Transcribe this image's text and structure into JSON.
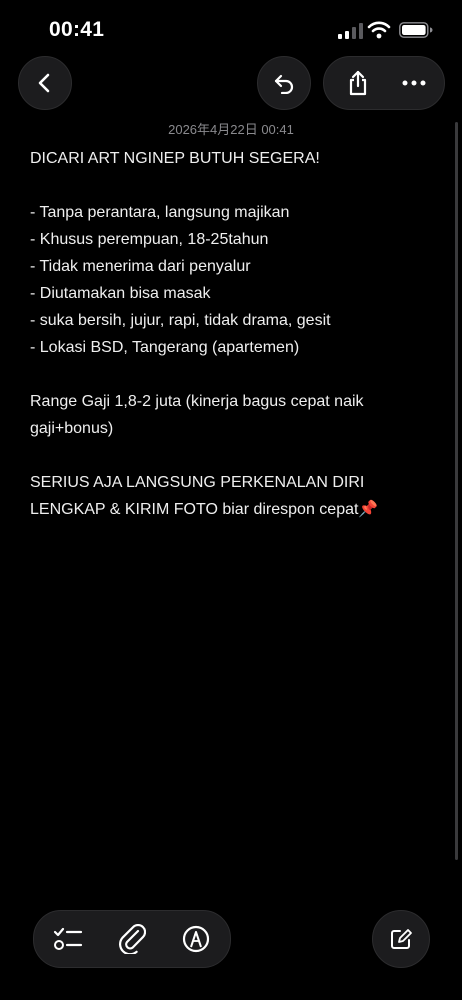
{
  "status_bar": {
    "time": "00:41",
    "icons": [
      "cellular-signal-icon",
      "wifi-icon",
      "battery-icon"
    ]
  },
  "toolbar": {
    "icons": [
      "chevron-left-icon",
      "undo-icon",
      "share-icon",
      "more-icon"
    ]
  },
  "note": {
    "date_stamp": "2026年4月22日 00:41",
    "lines": [
      "DICARI ART NGINEP BUTUH SEGERA!",
      "",
      "- Tanpa perantara, langsung majikan",
      "- Khusus perempuan, 18-25tahun",
      "- Tidak menerima dari penyalur",
      "- Diutamakan bisa masak",
      "- suka bersih, jujur, rapi, tidak drama, gesit",
      "- Lokasi BSD, Tangerang (apartemen)",
      "",
      "Range Gaji 1,8-2 juta (kinerja bagus cepat naik",
      "gaji+bonus)",
      "",
      "SERIUS AJA LANGSUNG PERKENALAN DIRI",
      "LENGKAP & KIRIM FOTO biar direspon cepat📌"
    ]
  },
  "bottom_bar": {
    "icons": [
      "checklist-icon",
      "paperclip-icon",
      "markup-pen-icon",
      "compose-icon"
    ]
  },
  "colors": {
    "background": "#000000",
    "button_fill": "#1c1c1e",
    "text": "#efefef",
    "date_text": "#8a8a8e"
  }
}
